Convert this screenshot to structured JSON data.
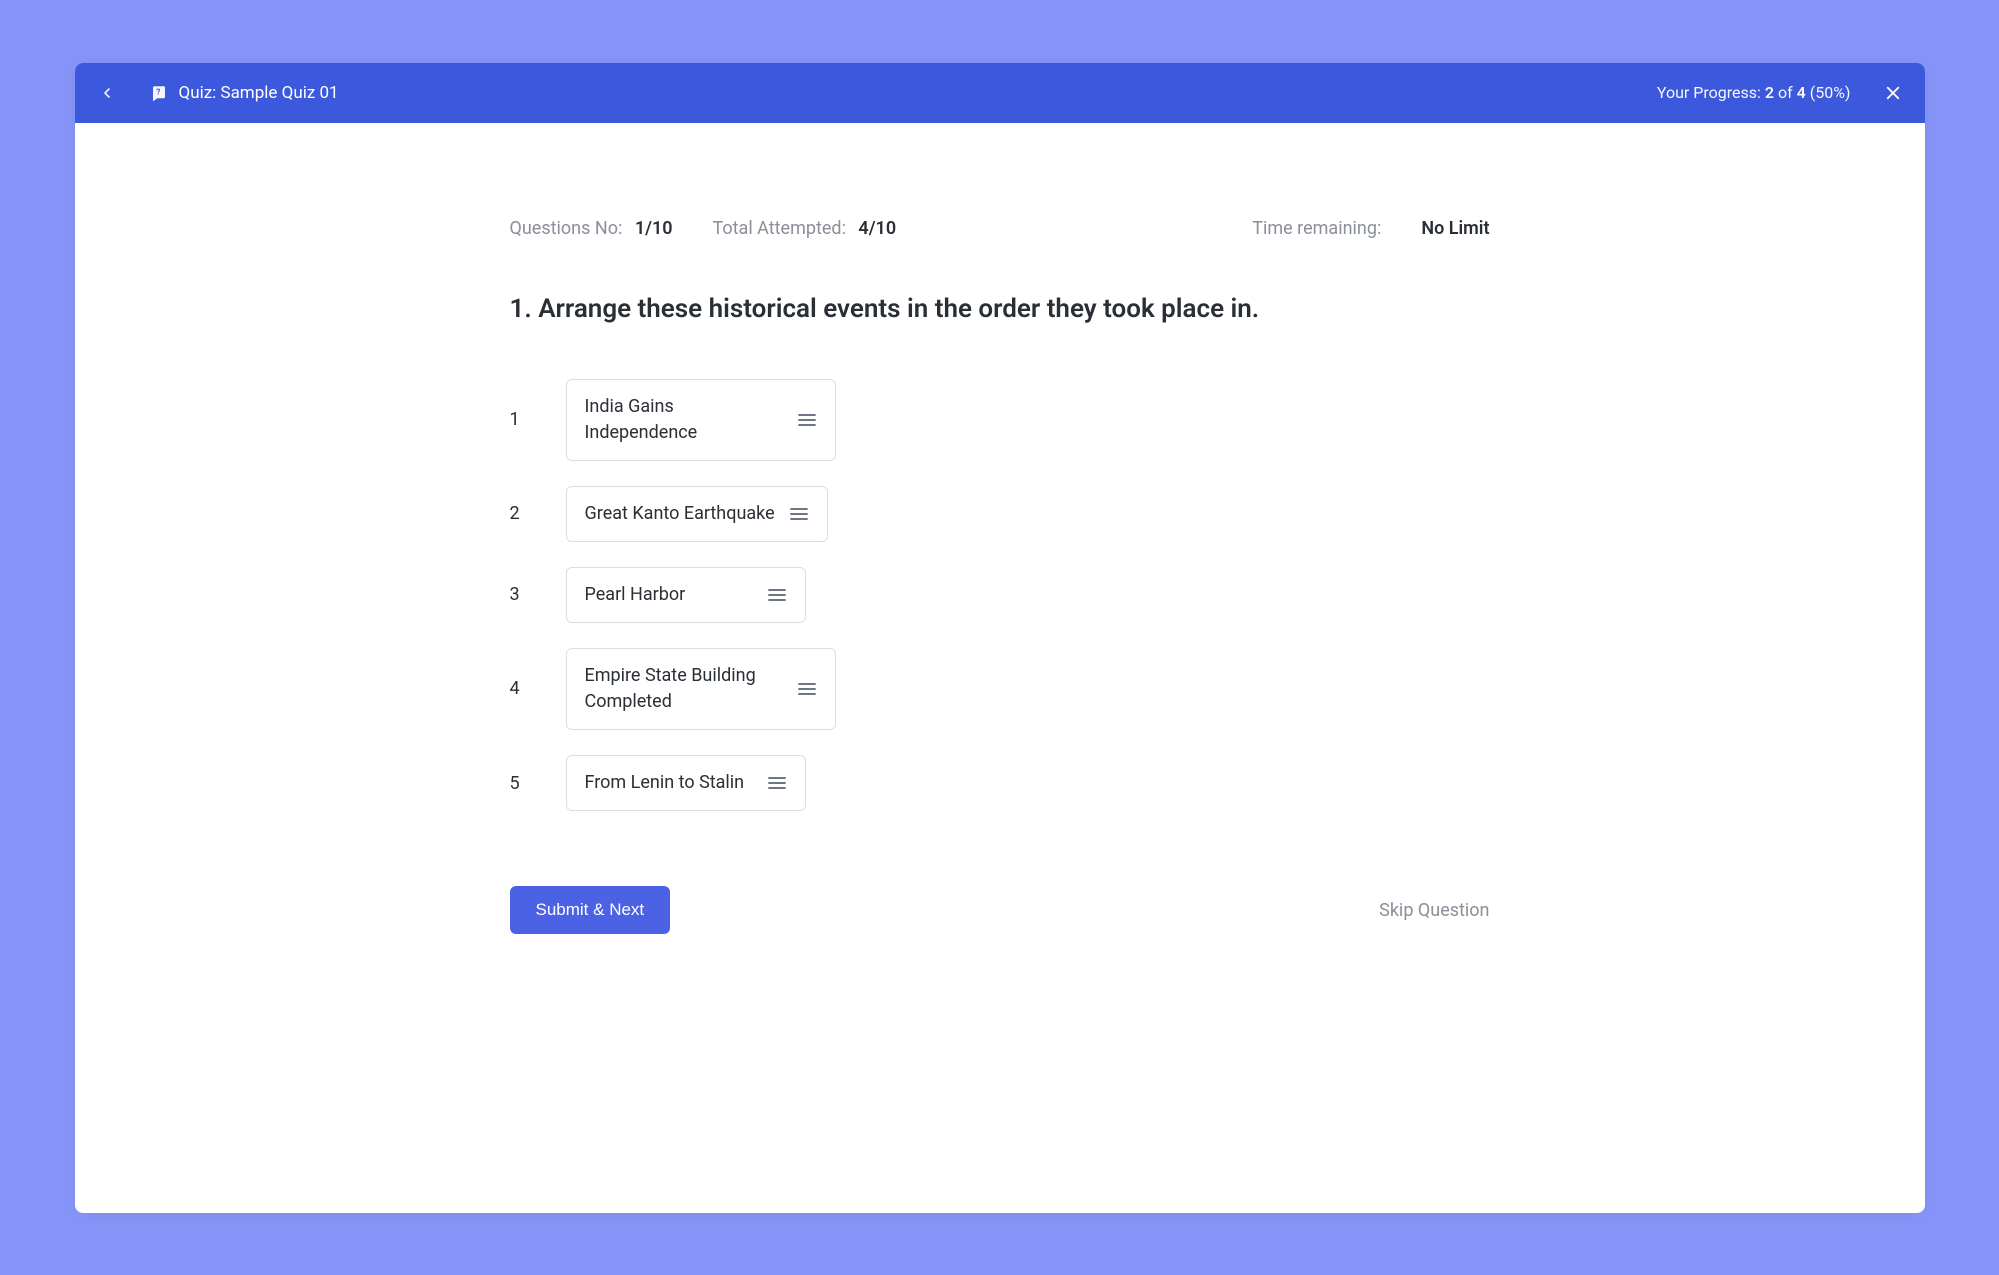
{
  "header": {
    "title": "Quiz: Sample Quiz 01",
    "progress_label": "Your Progress:",
    "progress_current": "2",
    "progress_of": "of",
    "progress_total": "4",
    "progress_pct": "(50%)"
  },
  "meta": {
    "question_no_label": "Questions No:",
    "question_no_value": "1/10",
    "attempted_label": "Total Attempted:",
    "attempted_value": "4/10",
    "time_label": "Time remaining:",
    "time_value": "No Limit"
  },
  "question": {
    "text": "1. Arrange these historical events in the order they took place in."
  },
  "items": [
    {
      "num": "1",
      "label": "India Gains Independence"
    },
    {
      "num": "2",
      "label": "Great Kanto Earthquake"
    },
    {
      "num": "3",
      "label": "Pearl Harbor"
    },
    {
      "num": "4",
      "label": "Empire State Building Completed"
    },
    {
      "num": "5",
      "label": "From Lenin to Stalin"
    }
  ],
  "actions": {
    "submit": "Submit & Next",
    "skip": "Skip Question"
  }
}
